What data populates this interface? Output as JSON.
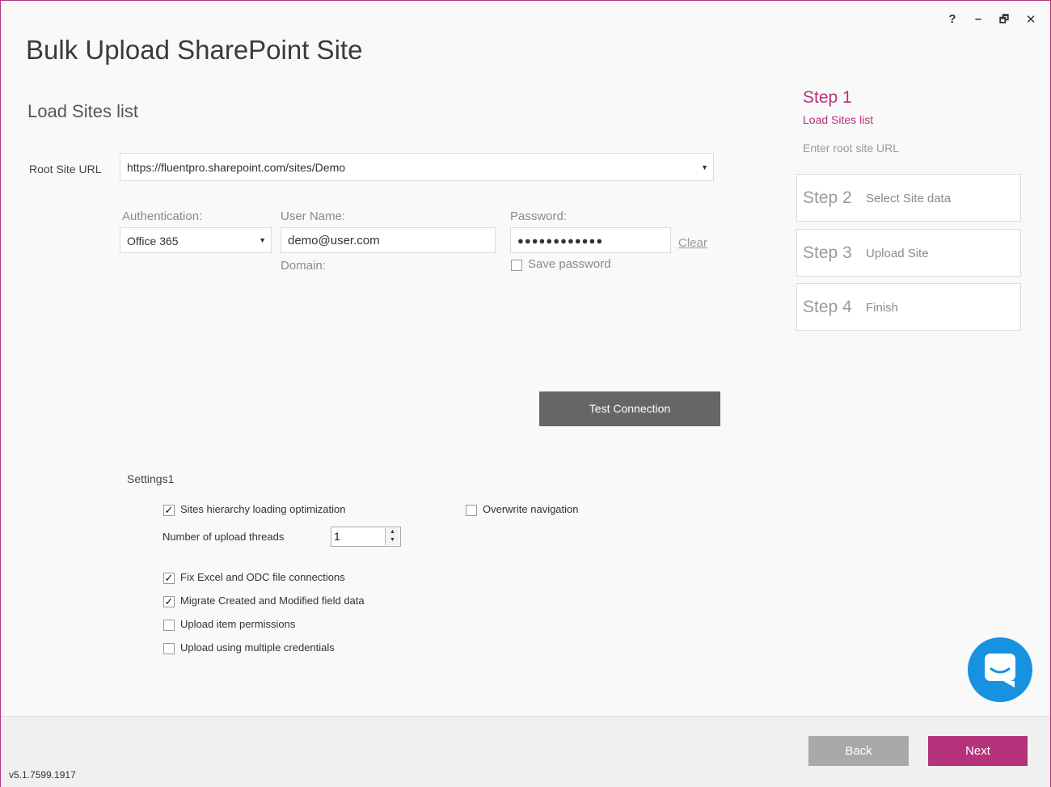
{
  "window": {
    "title": "Bulk Upload SharePoint Site",
    "controls": {
      "help": "?",
      "minimize": "–",
      "restore": "🗗",
      "close": "✕"
    }
  },
  "page": {
    "subtitle": "Load Sites list"
  },
  "root_site": {
    "label": "Root Site URL",
    "value": "https://fluentpro.sharepoint.com/sites/Demo"
  },
  "auth": {
    "label": "Authentication:",
    "value": "Office 365",
    "username_label": "User Name:",
    "username_value": "demo@user.com",
    "domain_label": "Domain:",
    "password_label": "Password:",
    "password_value": "●●●●●●●●●●●●",
    "clear_label": "Clear",
    "save_password_label": "Save password"
  },
  "test_connection_label": "Test Connection",
  "settings": {
    "title": "Settings1",
    "sites_hierarchy": {
      "label": "Sites hierarchy loading optimization",
      "checked": true
    },
    "overwrite_navigation": {
      "label": "Overwrite navigation",
      "checked": false
    },
    "threads_label": "Number of upload threads",
    "threads_value": "1",
    "fix_excel": {
      "label": "Fix Excel and ODC file connections",
      "checked": true
    },
    "migrate_created": {
      "label": "Migrate Created and Modified field data",
      "checked": true
    },
    "upload_permissions": {
      "label": "Upload item permissions",
      "checked": false
    },
    "multiple_credentials": {
      "label": "Upload using multiple credentials",
      "checked": false
    }
  },
  "steps": {
    "current": {
      "number": "Step 1",
      "name": "Load Sites list",
      "hint": "Enter root site URL"
    },
    "others": [
      {
        "number": "Step 2",
        "name": "Select Site data"
      },
      {
        "number": "Step 3",
        "name": "Upload Site"
      },
      {
        "number": "Step 4",
        "name": "Finish"
      }
    ]
  },
  "footer": {
    "back_label": "Back",
    "next_label": "Next",
    "version": "v5.1.7599.1917"
  },
  "colors": {
    "accent": "#b4337a",
    "chat": "#1792e0",
    "button_gray": "#666666",
    "back_button": "#a9a9a9"
  },
  "icons": {
    "chat": "chat-bubble-icon",
    "dropdown": "chevron-down-icon",
    "spinner": "spinner-arrows-icon"
  }
}
